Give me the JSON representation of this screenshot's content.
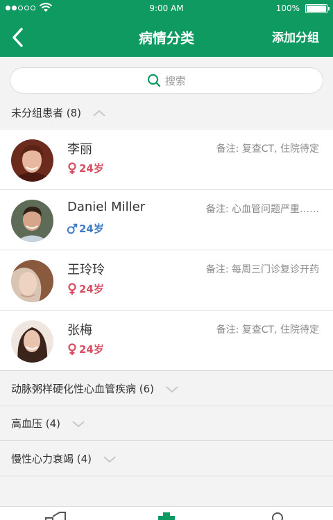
{
  "status_bar": {
    "time": "9:00 AM",
    "battery": "100%",
    "battery_level": 1.0,
    "signal_bars": 2
  },
  "nav": {
    "title": "病情分类",
    "action": "添加分组"
  },
  "search": {
    "placeholder": "搜索"
  },
  "groups": [
    {
      "label": "未分组患者 (8)",
      "expanded": true
    },
    {
      "label": "动脉粥样硬化性心血管疾病 (6)",
      "expanded": false
    },
    {
      "label": "高血压 (4)",
      "expanded": false
    },
    {
      "label": "慢性心力衰竭 (4)",
      "expanded": false
    }
  ],
  "patients": [
    {
      "name": "李丽",
      "gender": "female",
      "age": "24岁",
      "note": "备注: 复查CT, 住院待定"
    },
    {
      "name": "Daniel Miller",
      "gender": "male",
      "age": "24岁",
      "note": "备注: 心血管问题严重……"
    },
    {
      "name": "王玲玲",
      "gender": "female",
      "age": "24岁",
      "note": "备注: 每周三门诊复诊开药"
    },
    {
      "name": "张梅",
      "gender": "female",
      "age": "24岁",
      "note": "备注: 复查CT, 住院待定"
    }
  ],
  "colors": {
    "primary": "#0f9a62",
    "female": "#d84d62",
    "male": "#3d7bc4"
  },
  "tab_icons": [
    "home-icon",
    "medical-cross-icon",
    "profile-icon"
  ]
}
